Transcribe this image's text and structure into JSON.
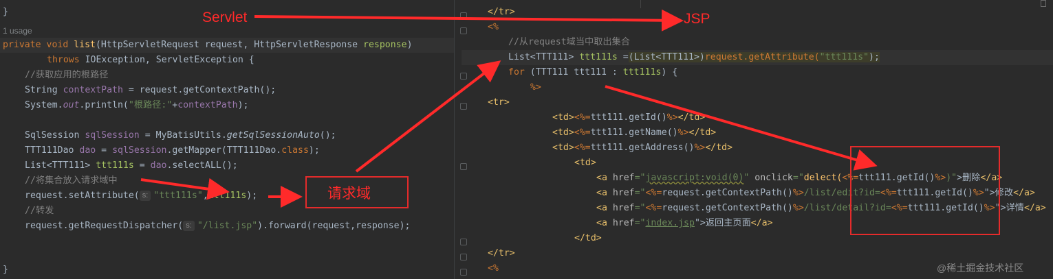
{
  "left_editor": {
    "line_top_brace": "}",
    "usage_hint": "1 usage",
    "sig_kw": "private void ",
    "sig_name": "list",
    "sig_rest1": "(HttpServletRequest ",
    "sig_p1": "request",
    "sig_rest2": ", HttpServletResponse ",
    "sig_p2": "response",
    "sig_end": ")",
    "throws_kw": "throws ",
    "throws_rest": "IOException, ServletException {",
    "c1": "//获取应用的根路径",
    "l_ctx_a": "String ",
    "l_ctx_b": "contextPath",
    "l_ctx_c": " = request.getContextPath();",
    "l_print_a": "System.",
    "l_print_b": "out",
    "l_print_c": ".println(",
    "l_print_d": "\"根路径:\"",
    "l_print_e": "+",
    "l_print_f": "contextPath",
    "l_print_g": ");",
    "l_sql_a": "SqlSession ",
    "l_sql_b": "sqlSession",
    "l_sql_c": " = MyBatisUtils.",
    "l_sql_d": "getSqlSessionAuto",
    "l_sql_e": "();",
    "l_dao_a": "TTT111Dao ",
    "l_dao_b": "dao",
    "l_dao_c": " = ",
    "l_dao_d": "sqlSession",
    "l_dao_e": ".getMapper(TTT111Dao.",
    "l_dao_f": "class",
    "l_dao_g": ");",
    "l_list_a": "List<TTT111> ",
    "l_list_b": "ttt111s",
    "l_list_c": " = ",
    "l_list_d": "dao",
    "l_list_e": ".selectALL();",
    "c2": "//将集合放入请求域中",
    "l_set_a": "request.setAttribute(",
    "l_set_hint": "s:",
    "l_set_b": "\"ttt111s\"",
    "l_set_c": ",",
    "l_set_d": "ttt111s",
    "l_set_e": ");",
    "c3": "//转发",
    "l_fwd_a": "request.getRequestDispatcher(",
    "l_fwd_hint": "s:",
    "l_fwd_b": "\"/list.jsp\"",
    "l_fwd_c": ").forward(request,response);",
    "line_bottom_brace": "}"
  },
  "right_editor": {
    "r1": "</tr>",
    "r2": "<%",
    "r3": "//从request域当中取出集合",
    "r4_a": "List<TTT111> ",
    "r4_b": "ttt111s",
    "r4_c": " =",
    "r4_d": "(List<TTT111>)",
    "r4_e": "request.getAttribute(",
    "r4_f": "\"ttt111s\"",
    "r4_g": ");",
    "r5_a": "for ",
    "r5_b": "(TTT111 ttt111 : ",
    "r5_c": "ttt111s",
    "r5_d": ") {",
    "r6": "%>",
    "r7": "<tr>",
    "r8_a": "<td>",
    "r8_b": "<%=",
    "r8_c": "ttt111.getId()",
    "r8_d": "%>",
    "r8_e": "</td>",
    "r9_c": "ttt111.getName()",
    "r10_c": "ttt111.getAddress()",
    "r11": "<td>",
    "r12_a": "<a ",
    "r12_b": "href",
    "r12_c": "=\"",
    "r12_d": "javascript:void(0)",
    "r12_e": "\" ",
    "r12_f": "onclick",
    "r12_g": "=\"",
    "r12_h": "delect(",
    "r12_i": "<%=",
    "r12_j": "ttt111.getId()",
    "r12_k": "%>",
    "r12_l": ")\"",
    "r12_m": ">删除",
    "r12_n": "</a>",
    "r13_d": "<%=",
    "r13_e": "request.getContextPath()",
    "r13_f": "%>",
    "r13_g": "/list/edit?id=",
    "r13_h": "<%=",
    "r13_i": "ttt111.getId()",
    "r13_j": "%>",
    "r13_k": "\">修改",
    "r13_l": "</a>",
    "r14_g": "/list/detail?id=",
    "r14_k": "\">详情",
    "r15_d": "index.jsp",
    "r15_e": "\">返回主页面",
    "r15_f": "</a>",
    "r16": "</td>",
    "r17": "</tr>",
    "r18": "<%"
  },
  "annotations": {
    "servlet_label": "Servlet",
    "jsp_label": "JSP",
    "request_scope_label": "请求域",
    "color": "#ff2a2a"
  },
  "watermark": "@稀土掘金技术社区",
  "theme": {
    "background": "#2b2b2b",
    "keyword": "#cc7832",
    "function": "#ffc66d",
    "string": "#6a8759",
    "comment": "#808080",
    "field": "#9876aa",
    "tag": "#e8bf6a"
  }
}
